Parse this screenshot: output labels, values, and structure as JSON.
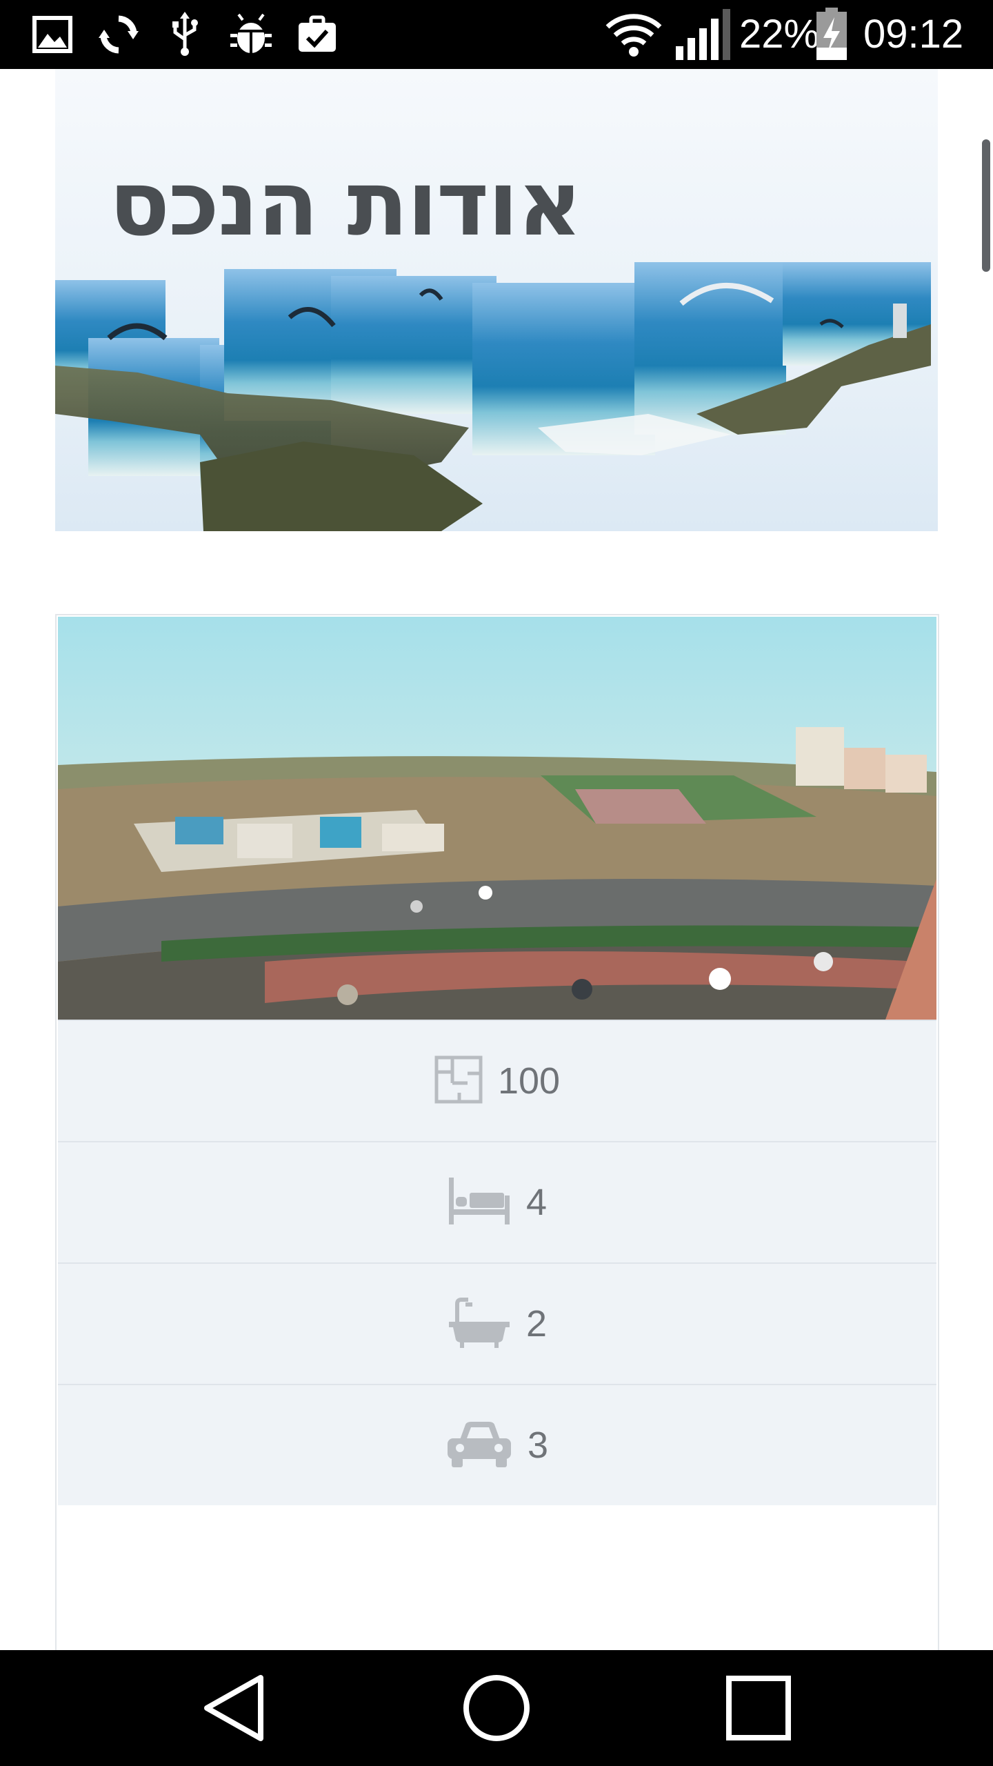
{
  "status_bar": {
    "battery_percent": "22%",
    "time": "09:12",
    "left_icons": [
      "gallery-icon",
      "sync-icon",
      "usb-icon",
      "android-debug-icon",
      "clipboard-check-icon"
    ],
    "right_icons": [
      "wifi-icon",
      "signal-icon",
      "battery-charging-icon"
    ]
  },
  "hero": {
    "title": "אודות הנכס"
  },
  "property": {
    "features": [
      {
        "icon": "floor-plan-icon",
        "value": "100"
      },
      {
        "icon": "bed-icon",
        "value": "4"
      },
      {
        "icon": "bathtub-icon",
        "value": "2"
      },
      {
        "icon": "car-icon",
        "value": "3"
      }
    ]
  },
  "nav_bar": {
    "buttons": [
      "back-icon",
      "home-icon",
      "recents-icon"
    ]
  },
  "colors": {
    "status_bar_bg": "#000000",
    "feature_row_bg": "#eff3f7",
    "title_color": "#4a4e52",
    "icon_gray": "#b8bcc1"
  }
}
